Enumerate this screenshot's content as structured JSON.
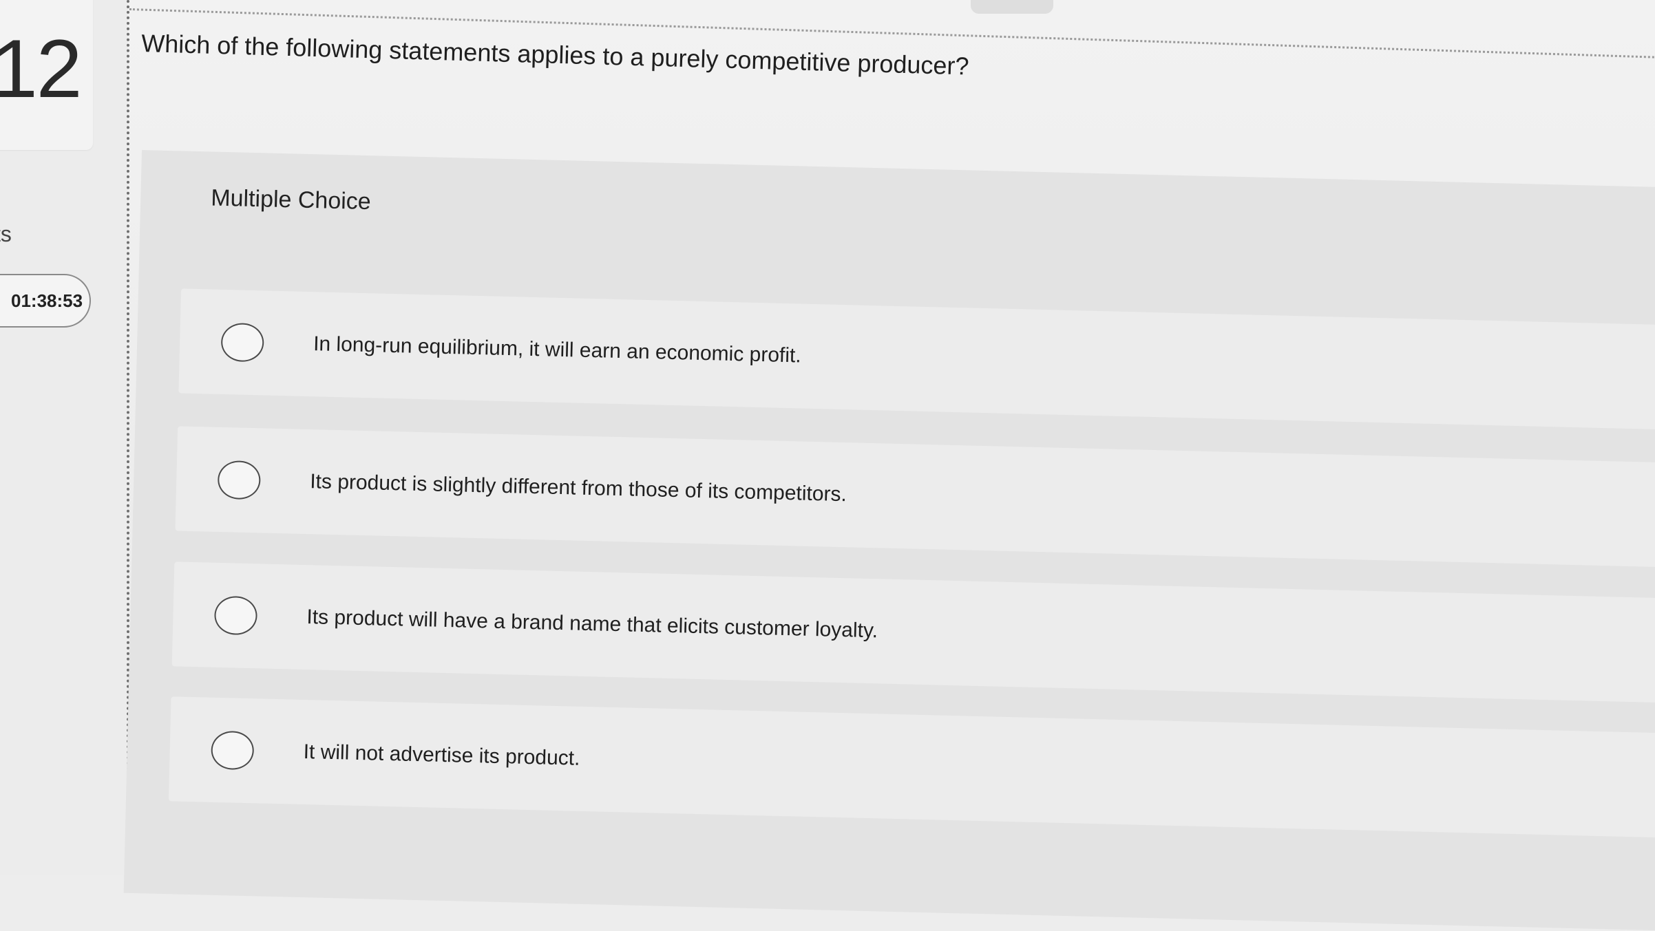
{
  "sidebar": {
    "question_number": "12",
    "points_label": "ts",
    "timer": "01:38:53"
  },
  "question": {
    "prompt": "Which of the following statements applies to a purely competitive producer?"
  },
  "answers": {
    "type_label": "Multiple Choice",
    "options": [
      {
        "label": "In long-run equilibrium, it will earn an economic profit.",
        "selected": false
      },
      {
        "label": "Its product is slightly different from those of its competitors.",
        "selected": false
      },
      {
        "label": "Its product will have a brand name that elicits customer loyalty.",
        "selected": false
      },
      {
        "label": "It will not advertise its product.",
        "selected": false
      }
    ]
  }
}
